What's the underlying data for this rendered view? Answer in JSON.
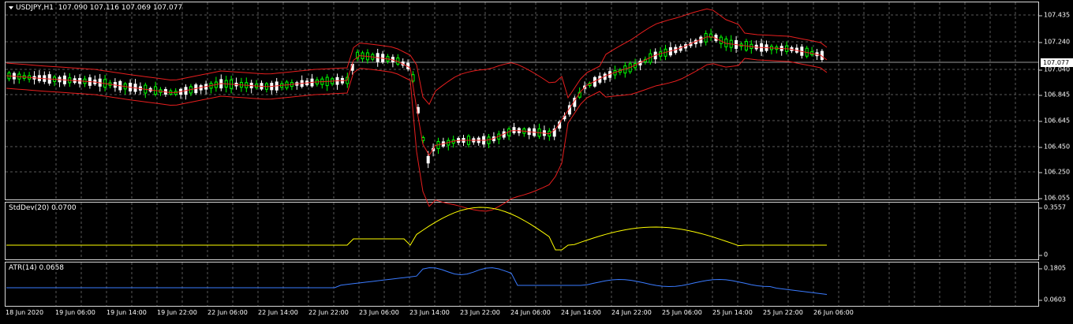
{
  "main": {
    "symbol": "USDJPY,H1",
    "ohlc": "107.090 107.116 107.069 107.077",
    "price_axis": [
      "107.435",
      "107.240",
      "107.040",
      "106.845",
      "106.645",
      "106.450",
      "106.250",
      "106.055"
    ],
    "current_price": "107.077",
    "colors": {
      "bull": "#00ff00",
      "bear": "#ffffff",
      "bands": "#e81e1e",
      "grid": "#5a5a5a"
    }
  },
  "stddev": {
    "label": "StdDev(20) 0.0700",
    "axis": [
      "0.3557",
      "0"
    ],
    "color": "#ffff00"
  },
  "atr": {
    "label": "ATR(14) 0.0658",
    "axis": [
      "0.1805",
      "0.0603"
    ],
    "color": "#3a7bff"
  },
  "time_axis": [
    "18 Jun 2020",
    "19 Jun 06:00",
    "19 Jun 14:00",
    "19 Jun 22:00",
    "22 Jun 06:00",
    "22 Jun 14:00",
    "22 Jun 22:00",
    "23 Jun 06:00",
    "23 Jun 14:00",
    "23 Jun 22:00",
    "24 Jun 06:00",
    "24 Jun 14:00",
    "24 Jun 22:00",
    "25 Jun 06:00",
    "25 Jun 14:00",
    "25 Jun 22:00",
    "26 Jun 06:00"
  ]
}
